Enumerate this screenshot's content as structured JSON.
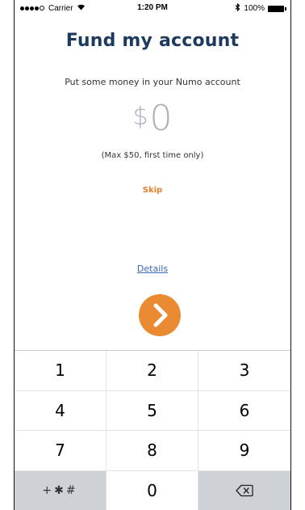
{
  "status_bar": {
    "carrier": "Carrier",
    "time": "1:20 PM",
    "battery": "100%"
  },
  "screen": {
    "title": "Fund my account",
    "subtitle": "Put some money in your Numo account",
    "currency_symbol": "$",
    "amount": "0",
    "max_note": "(Max $50, first time only)",
    "skip_label": "Skip",
    "details_label": "Details",
    "next_icon": "chevron-right-icon"
  },
  "keypad": {
    "keys": [
      "1",
      "2",
      "3",
      "4",
      "5",
      "6",
      "7",
      "8",
      "9",
      "+✱#",
      "0"
    ],
    "delete_icon": "backspace-icon"
  },
  "colors": {
    "title": "#1d3a5c",
    "accent": "#ea8a32",
    "link": "#3d66b4",
    "amount": "#aab0b8"
  }
}
